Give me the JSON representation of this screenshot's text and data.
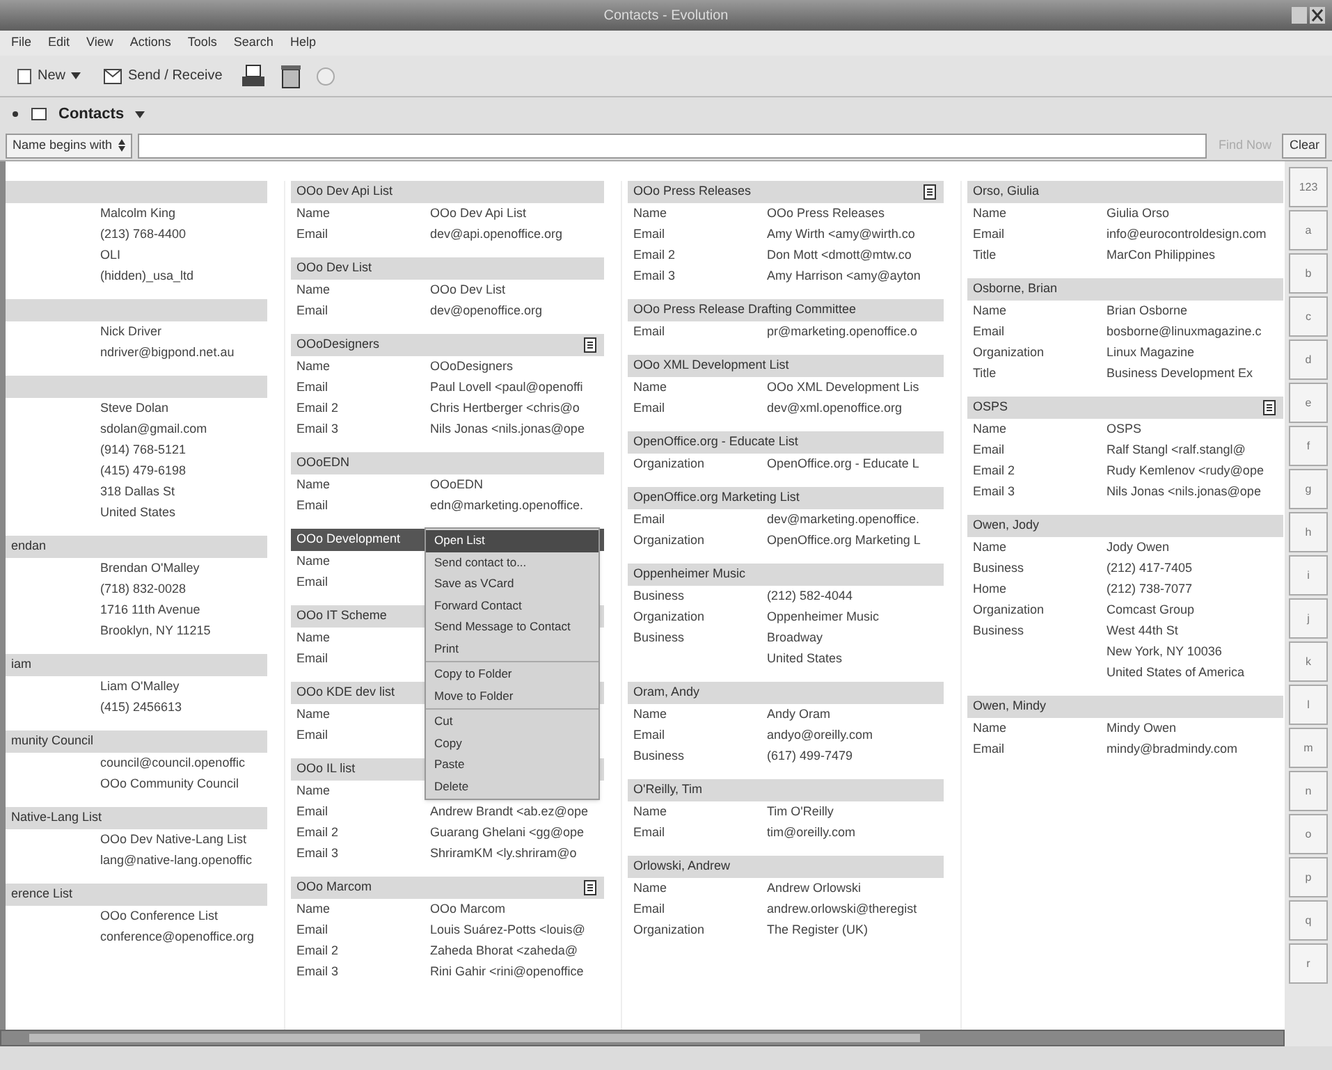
{
  "window": {
    "title": "Contacts - Evolution"
  },
  "menu": [
    "File",
    "Edit",
    "View",
    "Actions",
    "Tools",
    "Search",
    "Help"
  ],
  "toolbar": {
    "new_button": "New",
    "send_receive": "Send / Receive"
  },
  "header": {
    "title": "Contacts"
  },
  "search": {
    "mode": "Name begins with",
    "find_button": "Find Now",
    "clear_button": "Clear"
  },
  "columns": [
    {
      "cut": true,
      "cards": [
        {
          "list": false,
          "selected": false,
          "fields": [
            {
              "value": "Malcolm King"
            },
            {
              "value": "(213) 768-4400"
            },
            {
              "value": "OLI"
            },
            {
              "value": "(hidden)_usa_ltd"
            }
          ]
        },
        {
          "list": false,
          "selected": false,
          "fields": [
            {
              "value": "Nick Driver"
            },
            {
              "value": "ndriver@bigpond.net.au"
            }
          ]
        },
        {
          "list": false,
          "selected": false,
          "fields": [
            {
              "value": "Steve Dolan"
            },
            {
              "value": "sdolan@gmail.com"
            },
            {
              "value": "(914) 768-5121"
            },
            {
              "value": "(415) 479-6198"
            },
            {
              "value": "318 Dallas St"
            },
            {
              "value": "United States"
            }
          ]
        },
        {
          "header": "endan",
          "list": false,
          "selected": false,
          "fields": [
            {
              "value": "Brendan O'Malley"
            },
            {
              "value": "(718) 832-0028"
            },
            {
              "value": "1716 11th Avenue"
            },
            {
              "value": "Brooklyn, NY 11215"
            }
          ]
        },
        {
          "header": "iam",
          "list": false,
          "selected": false,
          "fields": [
            {
              "value": "Liam O'Malley"
            },
            {
              "value": "(415) 2456613"
            }
          ]
        },
        {
          "header": "munity Council",
          "list": false,
          "selected": false,
          "fields": [
            {
              "value": "council@council.openoffic"
            },
            {
              "value": "OOo Community Council"
            }
          ]
        },
        {
          "header": "Native-Lang List",
          "list": false,
          "selected": false,
          "fields": [
            {
              "value": "OOo Dev Native-Lang List"
            },
            {
              "value": "lang@native-lang.openoffic"
            }
          ]
        },
        {
          "header": "erence List",
          "list": false,
          "selected": false,
          "fields": [
            {
              "value": "OOo Conference List"
            },
            {
              "value": "conference@openoffice.org"
            }
          ]
        }
      ]
    },
    {
      "cut": false,
      "cards": [
        {
          "header": "OOo Dev Api List",
          "list": false,
          "selected": false,
          "fields": [
            {
              "label": "Name",
              "value": "OOo Dev Api List"
            },
            {
              "label": "Email",
              "value": "dev@api.openoffice.org"
            }
          ]
        },
        {
          "header": "OOo Dev List",
          "list": false,
          "selected": false,
          "fields": [
            {
              "label": "Name",
              "value": "OOo Dev List"
            },
            {
              "label": "Email",
              "value": "dev@openoffice.org"
            }
          ]
        },
        {
          "header": "OOoDesigners",
          "list": true,
          "selected": false,
          "fields": [
            {
              "label": "Name",
              "value": "OOoDesigners"
            },
            {
              "label": "Email",
              "value": "Paul Lovell <paul@openoffi"
            },
            {
              "label": "Email 2",
              "value": "Chris Hertberger <chris@o"
            },
            {
              "label": "Email 3",
              "value": "Nils Jonas <nils.jonas@ope"
            }
          ]
        },
        {
          "header": "OOoEDN",
          "list": false,
          "selected": false,
          "fields": [
            {
              "label": "Name",
              "value": "OOoEDN"
            },
            {
              "label": "Email",
              "value": "edn@marketing.openoffice."
            }
          ]
        },
        {
          "header": "OOo Development",
          "selected": true,
          "fields": [
            {
              "label": "Name"
            },
            {
              "label": "Email"
            }
          ]
        },
        {
          "header": "OOo IT Scheme",
          "selected": false,
          "fields": [
            {
              "label": "Name"
            },
            {
              "label": "Email"
            }
          ]
        },
        {
          "header": "OOo KDE dev list",
          "selected": false,
          "fields": [
            {
              "label": "Name"
            },
            {
              "label": "Email"
            }
          ]
        },
        {
          "header": "OOo IL list",
          "selected": false,
          "fields": [
            {
              "label": "Name"
            },
            {
              "label": "Email",
              "value": "Andrew Brandt <ab.ez@ope"
            },
            {
              "label": "Email 2",
              "value": "Guarang Ghelani <gg@ope"
            },
            {
              "label": "Email 3",
              "value": "ShriramKM <ly.shriram@o"
            }
          ]
        },
        {
          "header": "OOo Marcom",
          "list": true,
          "selected": false,
          "fields": [
            {
              "label": "Name",
              "value": "OOo Marcom"
            },
            {
              "label": "Email",
              "value": "Louis Suárez-Potts <louis@"
            },
            {
              "label": "Email 2",
              "value": "Zaheda Bhorat <zaheda@"
            },
            {
              "label": "Email 3",
              "value": "Rini Gahir <rini@openoffice"
            }
          ]
        }
      ]
    },
    {
      "cut": false,
      "cards": [
        {
          "header": "OOo Press Releases",
          "list": true,
          "selected": false,
          "fields": [
            {
              "label": "Name",
              "value": "OOo Press Releases"
            },
            {
              "label": "Email",
              "value": "Amy Wirth <amy@wirth.co"
            },
            {
              "label": "Email 2",
              "value": "Don Mott <dmott@mtw.co"
            },
            {
              "label": "Email 3",
              "value": "Amy Harrison <amy@ayton"
            }
          ]
        },
        {
          "header": "OOo Press Release Drafting Committee",
          "list": false,
          "selected": false,
          "fields": [
            {
              "label": "Email",
              "value": "pr@marketing.openoffice.o"
            }
          ]
        },
        {
          "header": "OOo XML Development List",
          "list": false,
          "selected": false,
          "fields": [
            {
              "label": "Name",
              "value": "OOo XML Development Lis"
            },
            {
              "label": "Email",
              "value": "dev@xml.openoffice.org"
            }
          ]
        },
        {
          "header": "OpenOffice.org - Educate List",
          "list": false,
          "selected": false,
          "fields": [
            {
              "label": "Organization",
              "value": "OpenOffice.org - Educate L"
            }
          ]
        },
        {
          "header": "OpenOffice.org Marketing List",
          "list": false,
          "selected": false,
          "fields": [
            {
              "label": "Email",
              "value": "dev@marketing.openoffice."
            },
            {
              "label": "Organization",
              "value": "OpenOffice.org Marketing L"
            }
          ]
        },
        {
          "header": "Oppenheimer Music",
          "list": false,
          "selected": false,
          "fields": [
            {
              "label": "Business",
              "value": "(212) 582-4044"
            },
            {
              "label": "Organization",
              "value": "Oppenheimer Music"
            },
            {
              "label": "Business",
              "value": "Broadway"
            },
            {
              "value": "United States"
            }
          ]
        },
        {
          "header": "Oram, Andy",
          "list": false,
          "selected": false,
          "fields": [
            {
              "label": "Name",
              "value": "Andy Oram"
            },
            {
              "label": "Email",
              "value": "andyo@oreilly.com"
            },
            {
              "label": "Business",
              "value": "(617) 499-7479"
            }
          ]
        },
        {
          "header": "O'Reilly, Tim",
          "list": false,
          "selected": false,
          "fields": [
            {
              "label": "Name",
              "value": "Tim O'Reilly"
            },
            {
              "label": "Email",
              "value": "tim@oreilly.com"
            }
          ]
        },
        {
          "header": "Orlowski, Andrew",
          "list": false,
          "selected": false,
          "fields": [
            {
              "label": "Name",
              "value": "Andrew Orlowski"
            },
            {
              "label": "Email",
              "value": "andrew.orlowski@theregist"
            },
            {
              "label": "Organization",
              "value": "The Register (UK)"
            }
          ]
        }
      ]
    },
    {
      "cut": false,
      "cards": [
        {
          "header": "Orso, Giulia",
          "list": false,
          "selected": false,
          "fields": [
            {
              "label": "Name",
              "value": "Giulia Orso"
            },
            {
              "label": "Email",
              "value": "info@eurocontroldesign.com"
            },
            {
              "label": "Title",
              "value": "MarCon Philippines"
            }
          ]
        },
        {
          "header": "Osborne, Brian",
          "list": false,
          "selected": false,
          "fields": [
            {
              "label": "Name",
              "value": "Brian Osborne"
            },
            {
              "label": "Email",
              "value": "bosborne@linuxmagazine.c"
            },
            {
              "label": "Organization",
              "value": "Linux Magazine"
            },
            {
              "label": "Title",
              "value": "Business Development Ex"
            }
          ]
        },
        {
          "header": "OSPS",
          "list": true,
          "selected": false,
          "fields": [
            {
              "label": "Name",
              "value": "OSPS"
            },
            {
              "label": "Email",
              "value": "Ralf Stangl <ralf.stangl@"
            },
            {
              "label": "Email 2",
              "value": "Rudy Kemlenov <rudy@ope"
            },
            {
              "label": "Email 3",
              "value": "Nils Jonas <nils.jonas@ope"
            }
          ]
        },
        {
          "header": "Owen, Jody",
          "list": false,
          "selected": false,
          "fields": [
            {
              "label": "Name",
              "value": "Jody Owen"
            },
            {
              "label": "Business",
              "value": "(212) 417-7405"
            },
            {
              "label": "Home",
              "value": "(212) 738-7077"
            },
            {
              "label": "Organization",
              "value": "Comcast Group"
            },
            {
              "label": "Business",
              "value": "West 44th St"
            },
            {
              "value": "New York, NY 10036"
            },
            {
              "value": "United States of America"
            }
          ]
        },
        {
          "header": "Owen, Mindy",
          "list": false,
          "selected": false,
          "fields": [
            {
              "label": "Name",
              "value": "Mindy Owen"
            },
            {
              "label": "Email",
              "value": "mindy@bradmindy.com"
            }
          ]
        }
      ]
    }
  ],
  "context_menu": [
    {
      "label": "Open List",
      "selected": true,
      "kind": "item"
    },
    {
      "label": "Send contact to...",
      "selected": false,
      "kind": "item"
    },
    {
      "label": "Save as VCard",
      "selected": false,
      "kind": "item"
    },
    {
      "label": "Forward Contact",
      "selected": false,
      "kind": "item"
    },
    {
      "label": "Send Message to Contact",
      "selected": false,
      "kind": "item"
    },
    {
      "label": "Print",
      "selected": false,
      "kind": "item"
    },
    {
      "kind": "separator"
    },
    {
      "label": "Copy to Folder",
      "selected": false,
      "kind": "item"
    },
    {
      "label": "Move to Folder",
      "selected": false,
      "kind": "item"
    },
    {
      "kind": "separator"
    },
    {
      "label": "Cut",
      "selected": false,
      "kind": "item"
    },
    {
      "label": "Copy",
      "selected": false,
      "kind": "item"
    },
    {
      "label": "Paste",
      "selected": false,
      "kind": "item"
    },
    {
      "label": "Delete",
      "selected": false,
      "kind": "item"
    }
  ],
  "index_buttons": [
    "123",
    "a",
    "b",
    "c",
    "d",
    "e",
    "f",
    "g",
    "h",
    "i",
    "j",
    "k",
    "l",
    "m",
    "n",
    "o",
    "p",
    "q",
    "r"
  ]
}
